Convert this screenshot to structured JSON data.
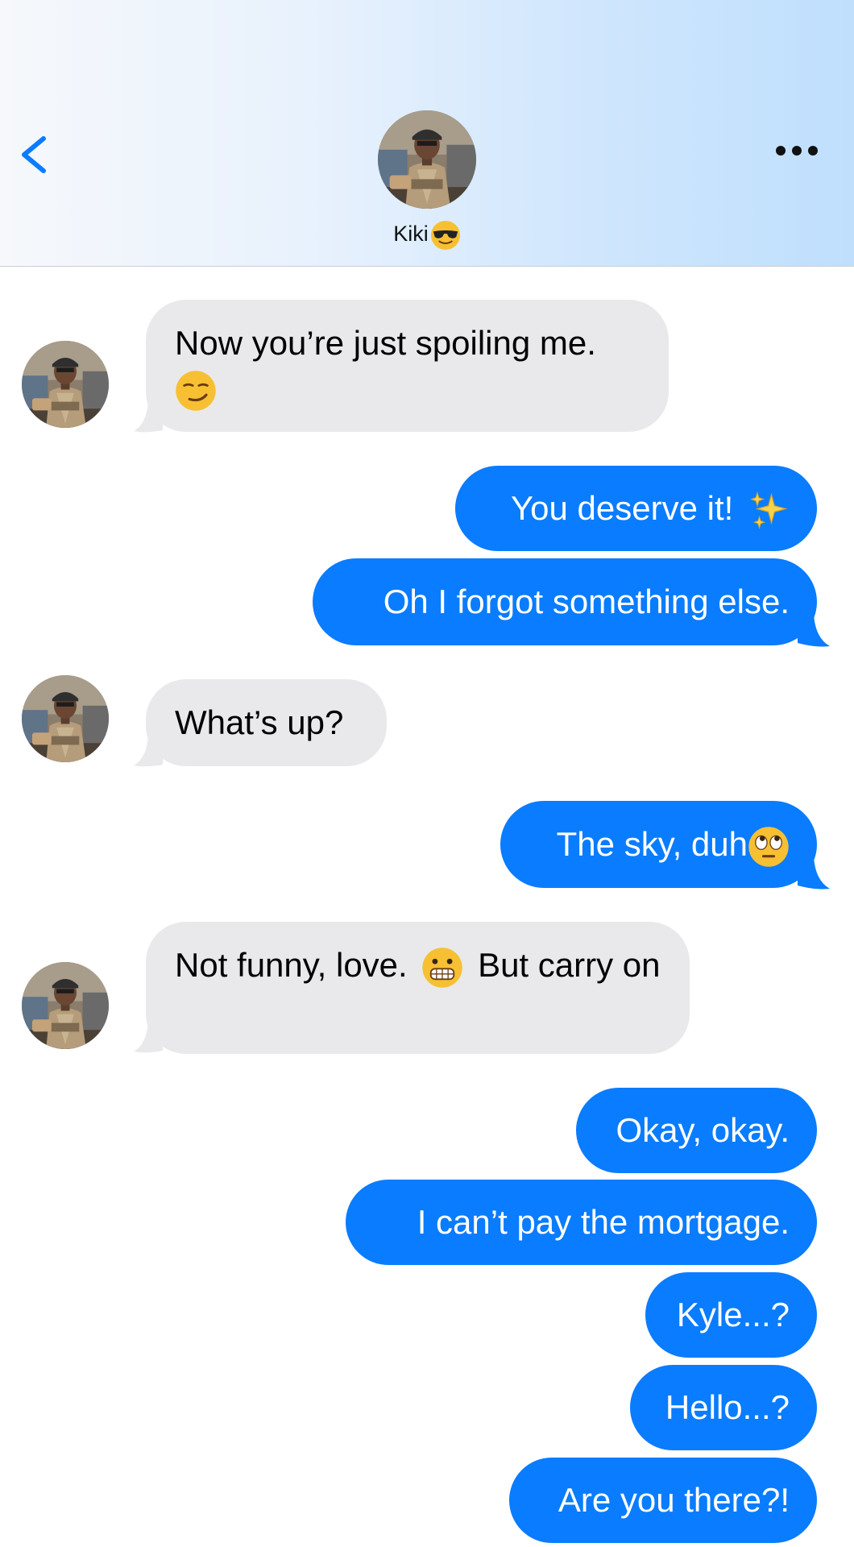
{
  "header": {
    "contact_name": "Kiki",
    "contact_emoji_icon": "sunglasses-face-icon",
    "back_icon": "chevron-left-icon",
    "more_icon": "more-dots-icon"
  },
  "colors": {
    "outgoing_bubble": "#0a7cff",
    "incoming_bubble": "#e9e9eb",
    "accent": "#0a7cff"
  },
  "messages": [
    {
      "direction": "incoming",
      "text": "Now you’re just spoiling me.",
      "emoji_icon": "smirking-face-icon"
    },
    {
      "direction": "outgoing",
      "text": "You deserve it!",
      "emoji_icon": "sparkles-icon"
    },
    {
      "direction": "outgoing",
      "text": "Oh I forgot something else."
    },
    {
      "direction": "incoming",
      "text": "What’s up?"
    },
    {
      "direction": "outgoing",
      "text": "The sky, duh",
      "emoji_icon": "eye-roll-face-icon"
    },
    {
      "direction": "incoming",
      "text_before": "Not funny, love.",
      "emoji_icon": "grimacing-face-icon",
      "text_after": "But carry on"
    },
    {
      "direction": "outgoing",
      "text": "Okay, okay."
    },
    {
      "direction": "outgoing",
      "text": "I can’t pay the mortgage."
    },
    {
      "direction": "outgoing",
      "text": "Kyle...?"
    },
    {
      "direction": "outgoing",
      "text": "Hello...?"
    },
    {
      "direction": "outgoing",
      "text": "Are you there?!"
    }
  ]
}
